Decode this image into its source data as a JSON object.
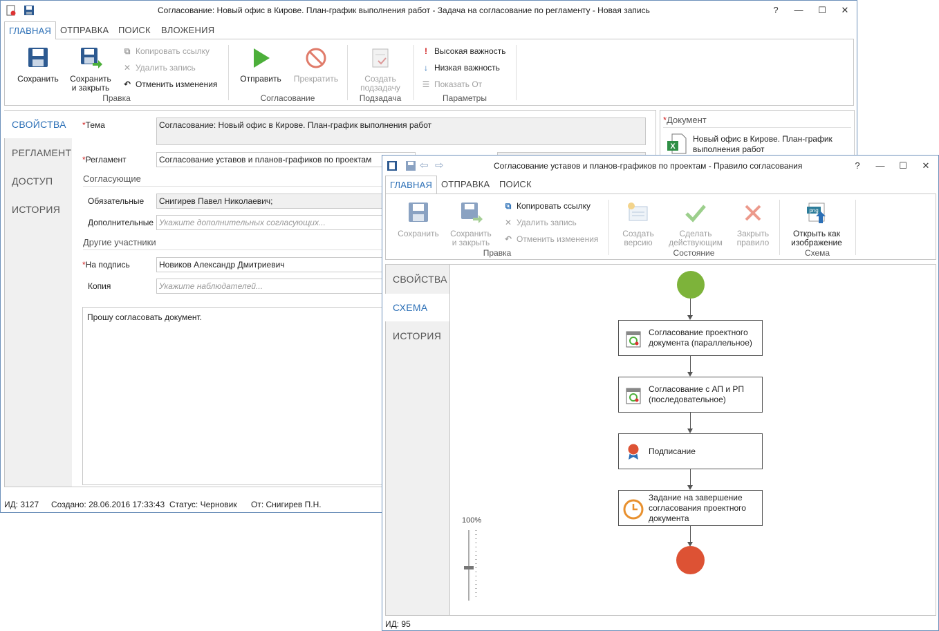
{
  "main_window": {
    "title": "Согласование: Новый офис в Кирове. План-график выполнения работ  - Задача на согласование по регламенту - Новая запись",
    "controls": {
      "help": "?",
      "minimize": "—",
      "maximize": "☐",
      "close": "✕"
    },
    "tabs": [
      "ГЛАВНАЯ",
      "ОТПРАВКА",
      "ПОИСК",
      "ВЛОЖЕНИЯ"
    ],
    "ribbon": {
      "save": "Сохранить",
      "save_close_1": "Сохранить",
      "save_close_2": "и закрыть",
      "copy_link": "Копировать ссылку",
      "delete": "Удалить запись",
      "undo": "Отменить изменения",
      "group_edit": "Правка",
      "send": "Отправить",
      "stop": "Прекратить",
      "group_approval": "Согласование",
      "subtask_1": "Создать",
      "subtask_2": "подзадачу",
      "group_subtask": "Подзадача",
      "high": "Высокая важность",
      "low": "Низкая важность",
      "show_from": "Показать От",
      "group_params": "Параметры"
    },
    "side_tabs": [
      "СВОЙСТВА",
      "РЕГЛАМЕНТ",
      "ДОСТУП",
      "ИСТОРИЯ"
    ],
    "form": {
      "required_mark": "*",
      "subject_label": "Тема",
      "subject_value": "Согласование: Новый офис в Кирове. План-график выполнения работ",
      "reglament_label": "Регламент",
      "reglament_value": "Согласование уставов и планов-графиков по проектам",
      "approvers_section": "Согласующие",
      "mandatory_label": "Обязательные",
      "mandatory_value": "Снигирев Павел Николаевич;",
      "additional_label": "Дополнительные",
      "additional_placeholder": "Укажите дополнительных согласующих...",
      "others_section": "Другие участники",
      "sign_label": "На подпись",
      "sign_value": "Новиков Александр Дмитриевич",
      "copy_label": "Копия",
      "copy_placeholder": "Укажите наблюдателей...",
      "comment": "Прошу согласовать документ."
    },
    "document_panel": {
      "header": "Документ",
      "name": "Новый офис в Кирове. План-график выполнения работ"
    },
    "status": {
      "id": "ИД: 3127",
      "created": "Создано: 28.06.2016 17:33:43",
      "state": "Статус: Черновик",
      "from": "От: Снигирев П.Н."
    }
  },
  "rule_window": {
    "title": "Согласование уставов и планов-графиков по проектам - Правило согласования",
    "controls": {
      "help": "?",
      "minimize": "—",
      "maximize": "☐",
      "close": "✕"
    },
    "tabs": [
      "ГЛАВНАЯ",
      "ОТПРАВКА",
      "ПОИСК"
    ],
    "ribbon": {
      "save": "Сохранить",
      "save_close_1": "Сохранить",
      "save_close_2": "и закрыть",
      "copy_link": "Копировать ссылку",
      "delete": "Удалить запись",
      "undo": "Отменить изменения",
      "group_edit": "Правка",
      "create_version_1": "Создать",
      "create_version_2": "версию",
      "make_active_1": "Сделать",
      "make_active_2": "действующим",
      "close_rule_1": "Закрыть",
      "close_rule_2": "правило",
      "group_state": "Состояние",
      "open_image_1": "Открыть как",
      "open_image_2": "изображение",
      "png_badge": "png",
      "group_scheme": "Схема"
    },
    "side_tabs": [
      "СВОЙСТВА",
      "СХЕМА",
      "ИСТОРИЯ"
    ],
    "diagram": {
      "nodes": [
        {
          "line1": "Согласование проектного",
          "line2": "документа (параллельное)",
          "line3": ""
        },
        {
          "line1": "Согласование с АП и РП",
          "line2": "(последовательное)",
          "line3": ""
        },
        {
          "line1": "Подписание",
          "line2": "",
          "line3": ""
        },
        {
          "line1": "Задание на завершение",
          "line2": "согласования проектного",
          "line3": "документа"
        }
      ],
      "zoom": "100%"
    },
    "status": {
      "id": "ИД: 95"
    }
  },
  "colors": {
    "accent": "#2b6fb6",
    "start": "#7db33a",
    "end": "#dd5234",
    "send": "#4caf3a",
    "stop": "#e07b6a",
    "warning": "#d02020"
  }
}
